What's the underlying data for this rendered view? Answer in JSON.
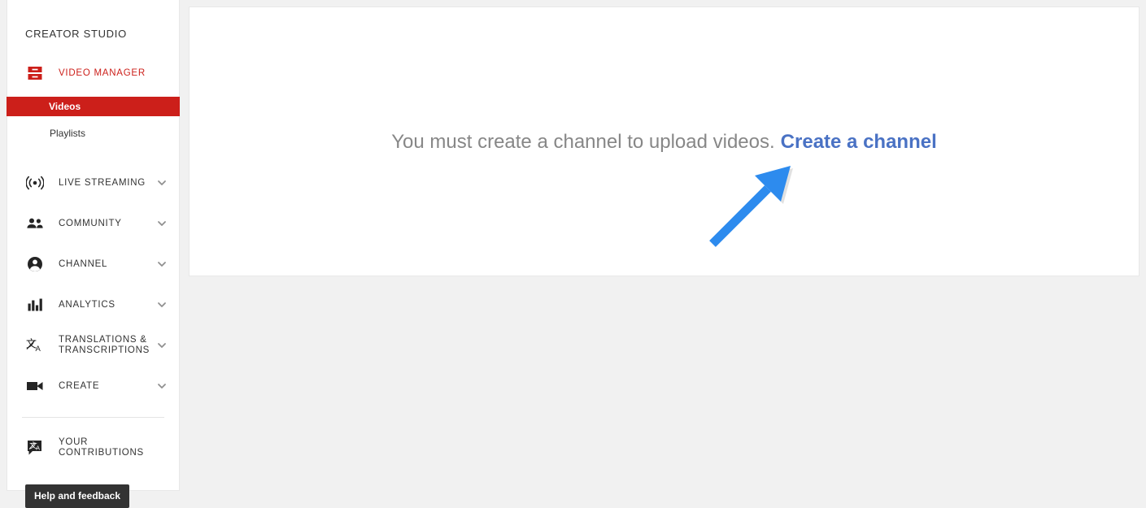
{
  "sidebar": {
    "title": "CREATOR STUDIO",
    "video_manager": {
      "label": "VIDEO MANAGER",
      "icon": "video-manager-icon",
      "sub_items": [
        {
          "label": "Videos",
          "active": true
        },
        {
          "label": "Playlists",
          "active": false
        }
      ]
    },
    "items": [
      {
        "label": "LIVE STREAMING",
        "icon": "broadcast-icon",
        "expandable": true
      },
      {
        "label": "COMMUNITY",
        "icon": "people-icon",
        "expandable": true
      },
      {
        "label": "CHANNEL",
        "icon": "account-circle-icon",
        "expandable": true
      },
      {
        "label": "ANALYTICS",
        "icon": "bar-chart-icon",
        "expandable": true
      },
      {
        "label": "TRANSLATIONS & TRANSCRIPTIONS",
        "icon": "translate-icon",
        "expandable": true
      },
      {
        "label": "CREATE",
        "icon": "video-camera-icon",
        "expandable": true
      }
    ],
    "contributions": {
      "label": "YOUR CONTRIBUTIONS",
      "icon": "translate-bubble-icon"
    },
    "help_button": "Help and feedback"
  },
  "main": {
    "empty_state_text": "You must create a channel to upload videos.",
    "empty_state_link": "Create a channel",
    "annotation": {
      "name": "blue-arrow-annotation",
      "color": "#2d8bee",
      "direction": "up-right"
    }
  },
  "colors": {
    "brand_red": "#cc1f1a",
    "link_blue": "#4a72c4",
    "arrow_blue": "#2d8bee",
    "page_bg": "#f1f1f1",
    "text_gray": "#878787",
    "dark_button": "#333333"
  }
}
